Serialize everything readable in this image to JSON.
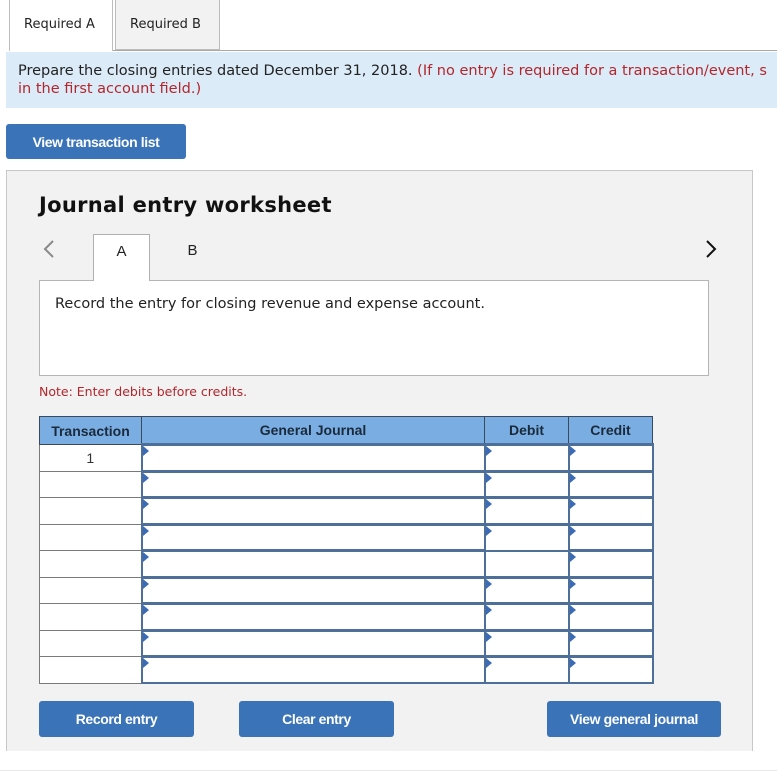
{
  "required_tabs": [
    {
      "label": "Required A",
      "active": true
    },
    {
      "label": "Required B",
      "active": false
    }
  ],
  "instructions": {
    "main": "Prepare the closing entries dated December 31, 2018.",
    "note": "(If no entry is required for a transaction/event, select \"No Journal Entry Required\" in the first account field.)",
    "note_line1": "(If no entry is required for a transaction/event, s",
    "note_line2": "in the first account field.)"
  },
  "buttons": {
    "view_transaction_list": "View transaction list",
    "record_entry": "Record entry",
    "clear_entry": "Clear entry",
    "view_general_journal": "View general journal"
  },
  "worksheet": {
    "title": "Journal entry worksheet",
    "nav_prev_icon": "chevron-left-icon",
    "nav_next_icon": "chevron-right-icon",
    "entry_tabs": [
      {
        "label": "A",
        "active": true
      },
      {
        "label": "B",
        "active": false
      }
    ],
    "description": "Record the entry for closing revenue and expense account.",
    "note": "Note: Enter debits before credits.",
    "table": {
      "headers": [
        "Transaction",
        "General Journal",
        "Debit",
        "Credit"
      ],
      "rows": [
        {
          "transaction": "1",
          "account": "",
          "debit": "",
          "credit": ""
        },
        {
          "transaction": "",
          "account": "",
          "debit": "",
          "credit": ""
        },
        {
          "transaction": "",
          "account": "",
          "debit": "",
          "credit": ""
        },
        {
          "transaction": "",
          "account": "",
          "debit": "",
          "credit": ""
        },
        {
          "transaction": "",
          "account": "",
          "debit": "",
          "credit": ""
        },
        {
          "transaction": "",
          "account": "",
          "debit": "",
          "credit": ""
        },
        {
          "transaction": "",
          "account": "",
          "debit": "",
          "credit": ""
        },
        {
          "transaction": "",
          "account": "",
          "debit": "",
          "credit": ""
        },
        {
          "transaction": "",
          "account": "",
          "debit": "",
          "credit": ""
        }
      ],
      "focused_cell": {
        "row": 4,
        "column": "debit"
      }
    }
  }
}
